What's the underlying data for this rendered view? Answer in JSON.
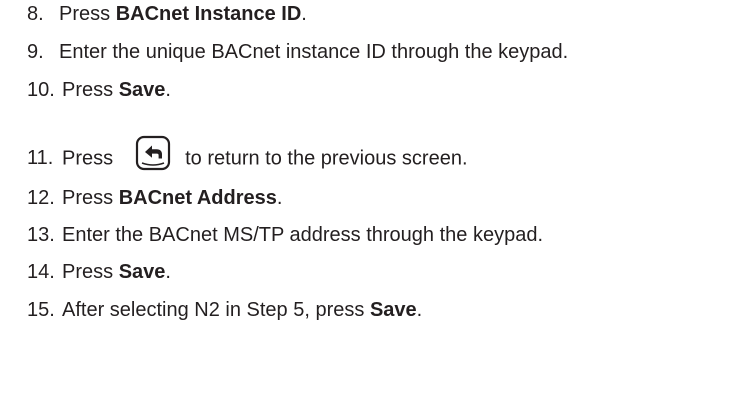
{
  "steps": [
    {
      "num": "8.",
      "pre": "Press ",
      "bold": "BACnet Instance ID",
      "post": "."
    },
    {
      "num": "9.",
      "text": "Enter the unique BACnet instance ID through the keypad."
    },
    {
      "num": "10.",
      "pre": "Press ",
      "bold": "Save",
      "post": "."
    },
    {
      "num": "11.",
      "pre": "Press",
      "icon": "back-arrow-icon",
      "post": "to return to the previous screen."
    },
    {
      "num": "12.",
      "pre": "Press ",
      "bold": "BACnet Address",
      "post": "."
    },
    {
      "num": "13.",
      "text": "Enter the BACnet MS/TP address through the keypad."
    },
    {
      "num": "14.",
      "pre": "Press ",
      "bold": "Save",
      "post": "."
    },
    {
      "num": "15.",
      "pre": "After selecting N2 in Step 5, press ",
      "bold": "Save",
      "post": "."
    }
  ]
}
